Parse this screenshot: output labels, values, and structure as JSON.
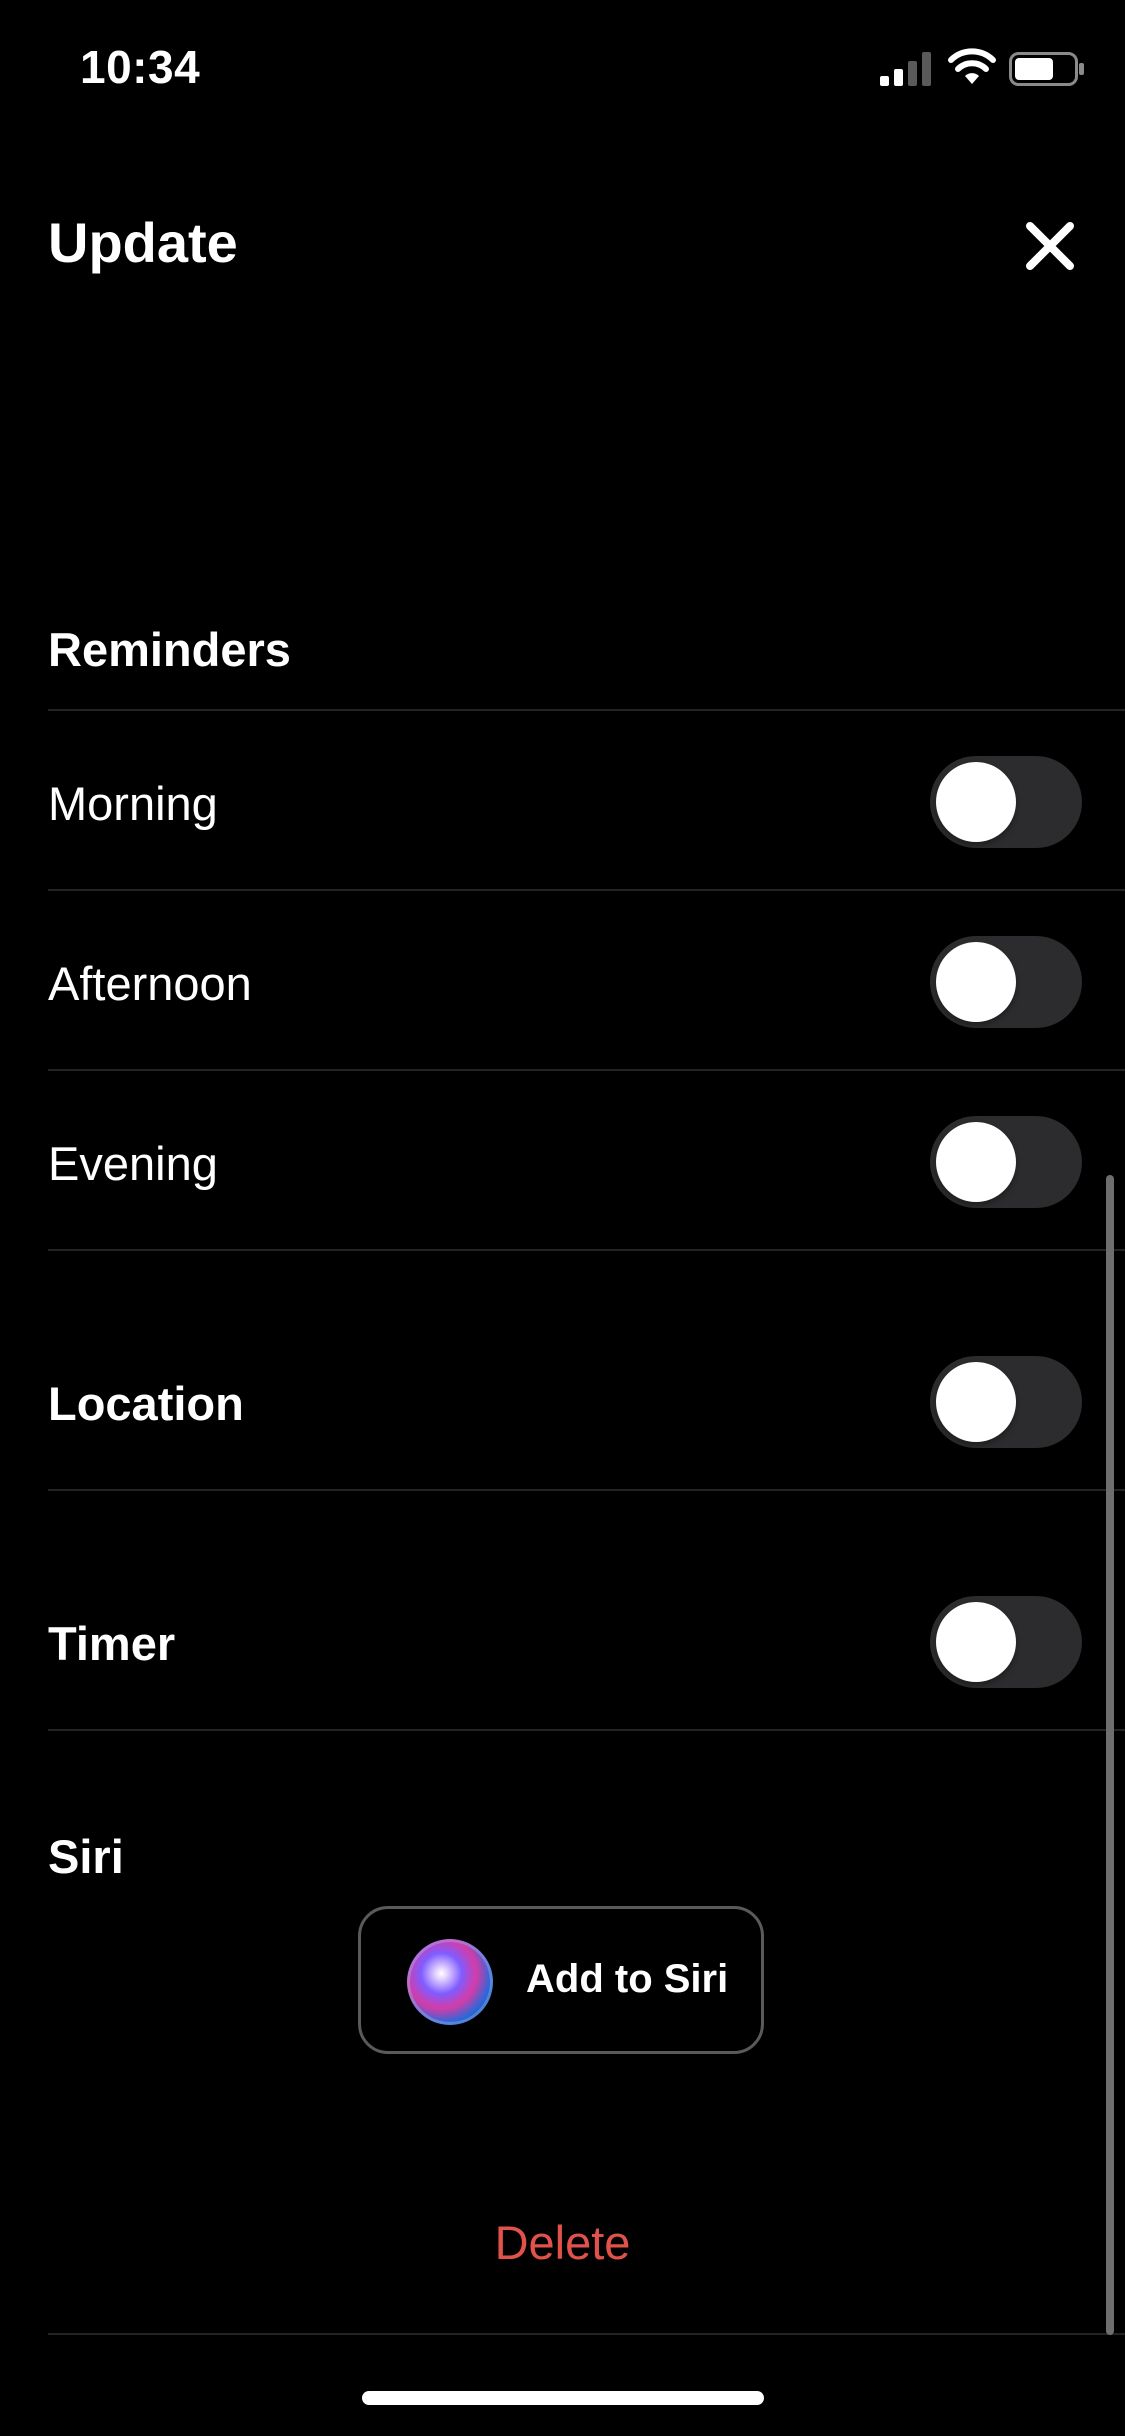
{
  "status_bar": {
    "time": "10:34"
  },
  "header": {
    "title": "Update",
    "close_icon": "close-icon"
  },
  "reminders": {
    "section_label": "Reminders",
    "items": [
      {
        "label": "Morning",
        "enabled": false
      },
      {
        "label": "Afternoon",
        "enabled": false
      },
      {
        "label": "Evening",
        "enabled": false
      }
    ]
  },
  "location": {
    "label": "Location",
    "enabled": false
  },
  "timer": {
    "label": "Timer",
    "enabled": false
  },
  "siri": {
    "section_label": "Siri",
    "button_label": "Add to Siri",
    "icon": "siri-icon"
  },
  "delete_label": "Delete",
  "colors": {
    "background": "#000000",
    "toggle_off": "#2c2c2e",
    "delete": "#e0524a",
    "divider": "#232323"
  }
}
